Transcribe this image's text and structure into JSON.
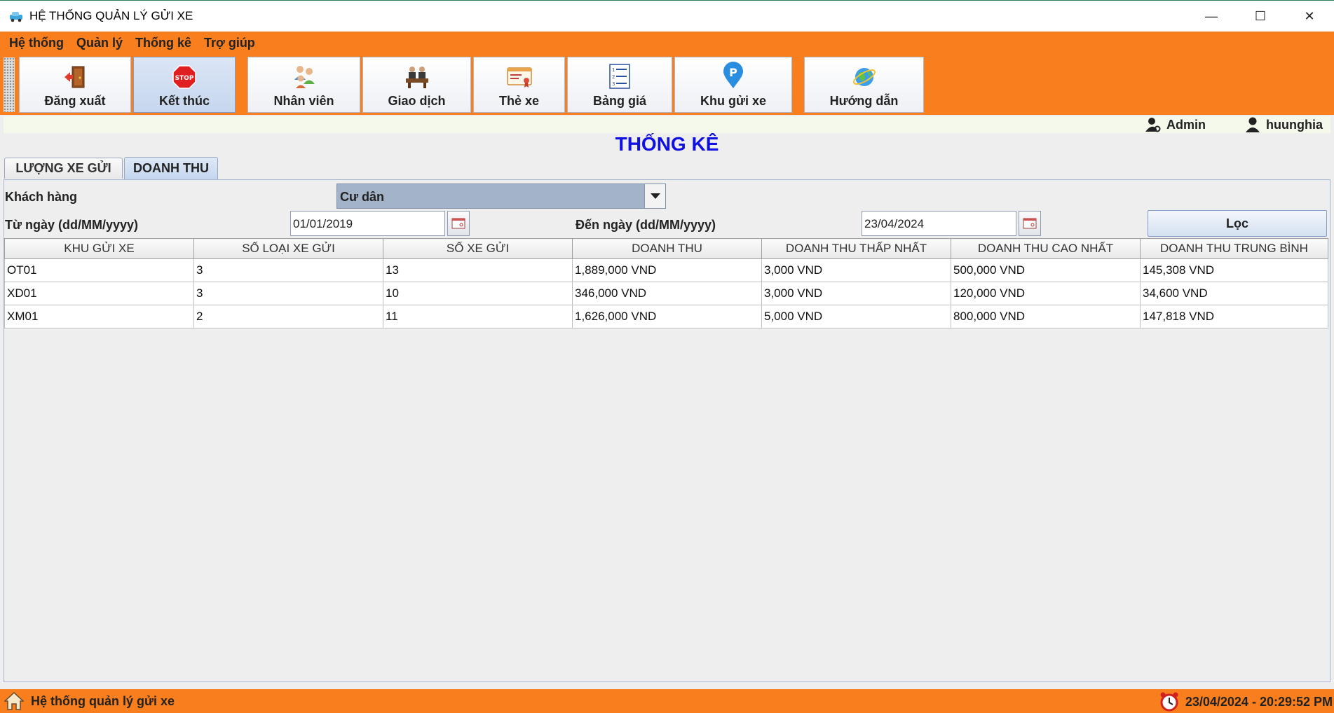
{
  "window": {
    "title": "HỆ THỐNG QUẢN LÝ GỬI XE",
    "minimize_glyph": "—",
    "maximize_glyph": "☐",
    "close_glyph": "✕"
  },
  "menu": [
    "Hệ thống",
    "Quản lý",
    "Thống kê",
    "Trợ giúp"
  ],
  "toolbar": {
    "logout": "Đăng xuất",
    "exit": "Kết thúc",
    "staff": "Nhân viên",
    "transactions": "Giao dịch",
    "cards": "Thẻ xe",
    "prices": "Bảng giá",
    "parking_zones": "Khu gửi xe",
    "help": "Hướng dẫn"
  },
  "users": {
    "role": "Admin",
    "username": "huunghia"
  },
  "page_title": "THỐNG KÊ",
  "tabs": [
    "LƯỢNG XE GỬI",
    "DOANH THU"
  ],
  "filters": {
    "customer_label": "Khách hàng",
    "customer_value": "Cư dân",
    "from_label": "Từ ngày (dd/MM/yyyy)",
    "from_value": "01/01/2019",
    "to_label": "Đến ngày (dd/MM/yyyy)",
    "to_value": "23/04/2024",
    "filter_button": "Lọc"
  },
  "table": {
    "headers": [
      "KHU GỬI XE",
      "SỐ LOẠI XE GỬI",
      "SỐ XE GỬI",
      "DOANH THU",
      "DOANH THU THẤP NHẤT",
      "DOANH THU CAO NHẤT",
      "DOANH THU TRUNG BÌNH"
    ],
    "rows": [
      [
        "OT01",
        "3",
        "13",
        "1,889,000 VND",
        "3,000 VND",
        "500,000 VND",
        "145,308 VND"
      ],
      [
        "XD01",
        "3",
        "10",
        "346,000 VND",
        "3,000 VND",
        "120,000 VND",
        "34,600 VND"
      ],
      [
        "XM01",
        "2",
        "11",
        "1,626,000 VND",
        "5,000 VND",
        "800,000 VND",
        "147,818 VND"
      ]
    ]
  },
  "status": {
    "app_name": "Hệ thống quản lý gửi xe",
    "datetime": "23/04/2024 - 20:29:52 PM"
  },
  "colors": {
    "accent": "#f97e1d",
    "title_blue": "#1010e0"
  }
}
